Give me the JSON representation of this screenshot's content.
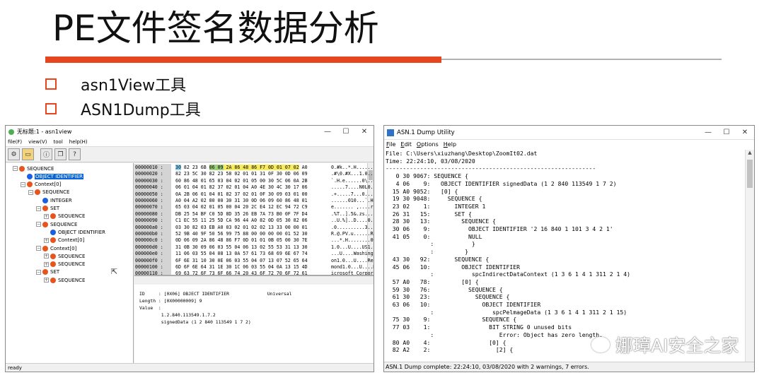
{
  "slide": {
    "title": "PE文件签名数据分析",
    "bullets": [
      "asn1View工具",
      "ASN1Dump工具"
    ]
  },
  "colors": {
    "accent": "#e6461e",
    "selection": "#0a64d6",
    "node_orange": "#e8541e",
    "node_blue": "#1e5ee0"
  },
  "asn1view": {
    "title": "无标题:1 - asn1view",
    "menu": [
      "file(F)",
      "view(V)",
      "tool",
      "help(H)"
    ],
    "toolbar_icons": [
      "tool-icon",
      "open-folder-icon",
      "info-icon",
      "copy-icon",
      "help-icon"
    ],
    "tree": [
      {
        "label": "SEQUENCE",
        "depth": 0,
        "kind": "orange",
        "expander": "⊟"
      },
      {
        "label": "OBJECT IDENTIFIER",
        "depth": 1,
        "kind": "blue",
        "expander": "",
        "selected": true
      },
      {
        "label": "Context[0]",
        "depth": 1,
        "kind": "orange",
        "expander": "⊟"
      },
      {
        "label": "SEQUENCE",
        "depth": 2,
        "kind": "orange",
        "expander": "⊟"
      },
      {
        "label": "INTEGER",
        "depth": 3,
        "kind": "blue",
        "expander": ""
      },
      {
        "label": "SET",
        "depth": 3,
        "kind": "orange",
        "expander": "⊟"
      },
      {
        "label": "SEQUENCE",
        "depth": 4,
        "kind": "orange",
        "expander": "⊞"
      },
      {
        "label": "SEQUENCE",
        "depth": 3,
        "kind": "orange",
        "expander": "⊟"
      },
      {
        "label": "OBJECT IDENTIFIER",
        "depth": 4,
        "kind": "blue",
        "expander": ""
      },
      {
        "label": "Context[0]",
        "depth": 4,
        "kind": "orange",
        "expander": "⊞"
      },
      {
        "label": "Context[0]",
        "depth": 3,
        "kind": "orange",
        "expander": "⊟"
      },
      {
        "label": "SEQUENCE",
        "depth": 4,
        "kind": "orange",
        "expander": "⊞"
      },
      {
        "label": "SEQUENCE",
        "depth": 4,
        "kind": "orange",
        "expander": "⊞"
      },
      {
        "label": "SET",
        "depth": 3,
        "kind": "orange",
        "expander": "⊟"
      },
      {
        "label": "SEQUENCE",
        "depth": 4,
        "kind": "orange",
        "expander": "⊞"
      }
    ],
    "hex_rows": [
      {
        "addr": "00000010 :",
        "pre": "",
        "blue": "30",
        "mid": " 82 23 6B ",
        "green": "06 09",
        "yellow": " 2A 86 48 86 F7 0D 01 07 02",
        "post": " A0",
        "ascii": "0.#k..*.H......."
      },
      {
        "addr": "00000020 :",
        "bytes": "82 23 5C 30 82 23 58 02 01 01 31 0F 30 0D 06 09",
        "ascii": ".#\\0.#X...1.0..."
      },
      {
        "addr": "00000030 :",
        "bytes": "60 86 48 01 65 03 04 02 01 05 00 30 5C 06 0A 2B",
        "ascii": "`.H.e......0\\..+"
      },
      {
        "addr": "00000040 :",
        "bytes": "06 01 04 01 82 37 02 01 04 A0 4E 30 4C 30 17 06",
        "ascii": ".....7....N0L0.."
      },
      {
        "addr": "00000050 :",
        "bytes": "0A 2B 06 01 04 01 82 37 02 01 0F 30 09 03 01 00",
        "ascii": ".+.....7...0...."
      },
      {
        "addr": "00000060 :",
        "bytes": "A0 04 A2 02 80 00 30 31 30 0D 06 09 60 86 48 01",
        "ascii": "......010...`.H."
      },
      {
        "addr": "00000070 :",
        "bytes": "65 03 04 02 01 05 00 04 20 2C E4 12 EC 94 72 C9",
        "ascii": "e....... ,....r."
      },
      {
        "addr": "00000080 :",
        "bytes": "DB 25 54 BF C0 5D 8D 35 26 EB 7A 73 B0 0F 7F D4",
        "ascii": ".%T..].5&.zs...."
      },
      {
        "addr": "00000090 :",
        "bytes": "C1 EC 55 11 25 5D CA 96 44 A0 82 0D 05 30 82 06",
        "ascii": "..U.%]..D....0.."
      },
      {
        "addr": "000000a0 :",
        "bytes": "03 30 82 03 EB A0 03 02 01 02 02 13 33 00 00 01",
        "ascii": ".0..........3..."
      },
      {
        "addr": "000000b0 :",
        "bytes": "52 9B 40 9F 50 56 99 75 88 00 00 00 00 01 52 30",
        "ascii": "R.@.PV.u......R0"
      },
      {
        "addr": "000000c0 :",
        "bytes": "0D 06 09 2A 86 48 86 F7 0D 01 01 0B 05 00 30 7E",
        "ascii": "...*.H........0~"
      },
      {
        "addr": "000000d0 :",
        "bytes": "31 0B 30 09 06 03 55 04 06 13 02 55 53 31 13 30",
        "ascii": "1.0...U....US1.0"
      },
      {
        "addr": "000000e0 :",
        "bytes": "11 06 03 55 04 08 13 0A 57 61 73 68 69 6E 67 74",
        "ascii": "...U....Washingt"
      },
      {
        "addr": "000000f0 :",
        "bytes": "6F 6E 31 10 30 0E 06 03 55 04 07 13 07 52 65 64",
        "ascii": "on1.0...U....Red"
      },
      {
        "addr": "00000100 :",
        "bytes": "6D 6F 6E 64 31 1E 30 1C 06 03 55 04 0A 13 15 4D",
        "ascii": "mond1.0...U....M"
      },
      {
        "addr": "00000110 :",
        "bytes": "69 63 72 6F 73 6F 66 74 20 43 6F 72 70 6F 72 61",
        "ascii": "icrosoft Corpora"
      }
    ],
    "detail_lines": [
      "ID     : [0X06] OBJECT IDENTIFIER              Universal",
      "Length : [0X00000009] 9",
      "Value  :",
      "        1.2.840.113549.1.7.2",
      "        signedData (1 2 840 113549 1 7 2)"
    ],
    "status": "ready"
  },
  "asn1dump": {
    "title": "ASN.1 Dump Utility",
    "menu": [
      {
        "key": "F",
        "rest": "ile"
      },
      {
        "key": "E",
        "rest": "dit"
      },
      {
        "key": "O",
        "rest": "ptions"
      },
      {
        "key": "H",
        "rest": "elp"
      }
    ],
    "lines": [
      "File: C:\\Users\\xiuzhang\\Desktop\\ZoomIt02.dat",
      "Time: 22:24:10, 03/08/2020",
      "-------------------------------------------------------------",
      "   0 30 9067: SEQUENCE {",
      "   4 06    9:   OBJECT IDENTIFIER signedData (1 2 840 113549 1 7 2)",
      "  15 A0 9052:   [0] {",
      "  19 30 9048:     SEQUENCE {",
      "  23 02    1:       INTEGER 1",
      "  26 31   15:       SET {",
      "  28 30   13:         SEQUENCE {",
      "  30 06    9:           OBJECT IDENTIFIER '2 16 840 1 101 3 4 2 1'",
      "  41 05    0:           NULL",
      "             :           }",
      "             :         }",
      "  43 30   92:       SEQUENCE {",
      "  45 06   10:         OBJECT IDENTIFIER",
      "             :           spcIndirectDataContext (1 3 6 1 4 1 311 2 1 4)",
      "  57 A0   78:         [0] {",
      "  59 30   76:           SEQUENCE {",
      "  61 30   23:             SEQUENCE {",
      "  63 06   10:               OBJECT IDENTIFIER",
      "             :                 spcPelmageData (1 3 6 1 4 1 311 2 1 15)",
      "  75 30    9:               SEQUENCE {",
      "  77 03    1:                 BIT STRING 0 unused bits",
      "             :                   Error: Object has zero length.",
      "  80 A0    4:                 [0] {",
      "  82 A2    2:                   [2] {"
    ],
    "status": "ASN.1 Dump complete: 22:24:10, 03/08/2020 with 2 warnings, 7 errors."
  },
  "watermark": "娜璋AI安全之家"
}
